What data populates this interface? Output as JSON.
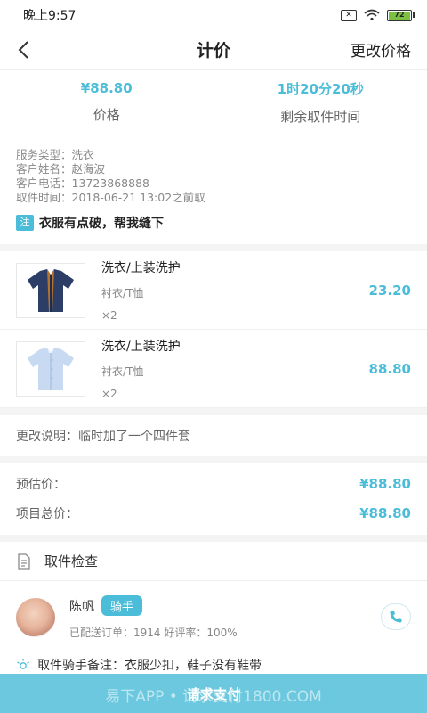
{
  "status_bar": {
    "time": "晚上9:57",
    "battery": "72"
  },
  "nav": {
    "title": "计价",
    "right": "更改价格"
  },
  "summary": [
    {
      "value": "¥88.80",
      "label": "价格"
    },
    {
      "value": "1时20分20秒",
      "label": "剩余取件时间"
    }
  ],
  "info": {
    "lines": [
      "服务类型：洗衣",
      "客户姓名：赵海波",
      "客户电话：13723868888",
      "取件时间：2018-06-21 13:02之前取"
    ],
    "note_tag": "注",
    "note": "衣服有点破，帮我缝下"
  },
  "items": [
    {
      "title": "洗衣/上装洗护",
      "sub": "衬衣/T恤",
      "qty": "×2",
      "price": "23.20"
    },
    {
      "title": "洗衣/上装洗护",
      "sub": "衬衣/T恤",
      "qty": "×2",
      "price": "88.80"
    }
  ],
  "change_note": "更改说明：临时加了一个四件套",
  "prices": [
    {
      "label": "预估价：",
      "value": "¥88.80"
    },
    {
      "label": "项目总价：",
      "value": "¥88.80"
    }
  ],
  "inspect_label": "取件检查",
  "rider": {
    "name": "陈帆",
    "badge": "骑手",
    "stats": "已配送订单：1914    好评率：100%"
  },
  "remark": "取件骑手备注：衣服少扣，鞋子没有鞋带",
  "pay_button": "请求支付",
  "watermark": "易下APP • 请求支付1800.COM",
  "colors": {
    "accent": "#4bbdd8",
    "pay_bar": "#6cc8de"
  }
}
